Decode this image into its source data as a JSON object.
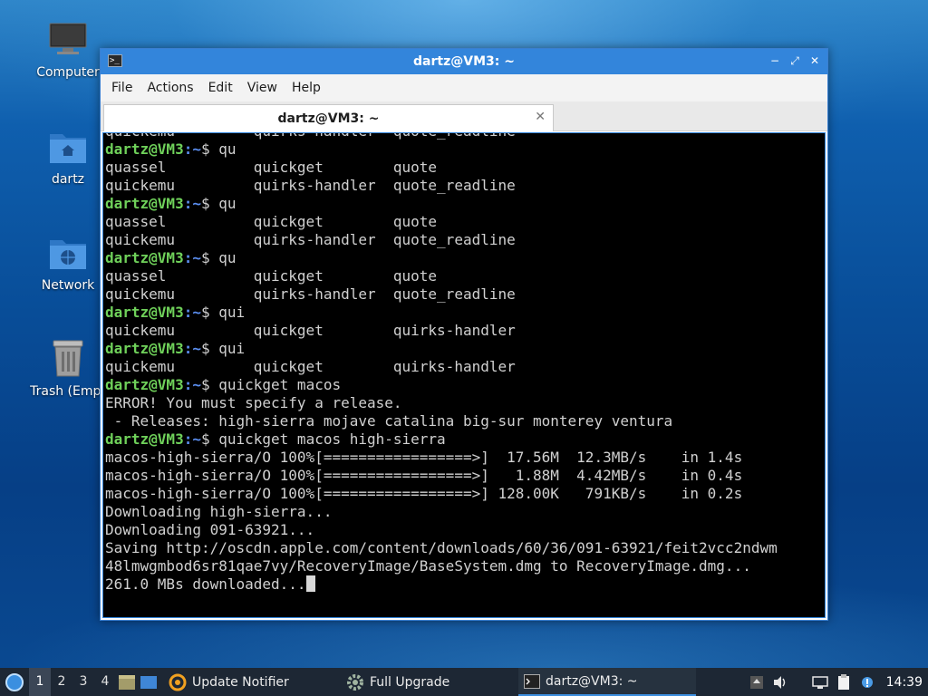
{
  "desktop": {
    "icons": [
      {
        "label": "Computer"
      },
      {
        "label": "dartz"
      },
      {
        "label": "Network"
      },
      {
        "label": "Trash (Empt"
      }
    ]
  },
  "window": {
    "title": "dartz@VM3: ~",
    "menu": [
      "File",
      "Actions",
      "Edit",
      "View",
      "Help"
    ],
    "tab": {
      "label": "dartz@VM3: ~",
      "close": "✕"
    },
    "buttons": {
      "minimize": "−",
      "maximize": "⤢",
      "close": "✕"
    }
  },
  "terminal": {
    "prompt_user": "dartz@VM3",
    "prompt_path": ":~",
    "prompt_sign": "$ ",
    "lines": [
      {
        "t": "out",
        "text": "quickemu         quirks-handler  quote_readline"
      },
      {
        "t": "cmd",
        "text": "qu"
      },
      {
        "t": "out",
        "text": "quassel          quickget        quote"
      },
      {
        "t": "out",
        "text": "quickemu         quirks-handler  quote_readline"
      },
      {
        "t": "cmd",
        "text": "qu"
      },
      {
        "t": "out",
        "text": "quassel          quickget        quote"
      },
      {
        "t": "out",
        "text": "quickemu         quirks-handler  quote_readline"
      },
      {
        "t": "cmd",
        "text": "qu"
      },
      {
        "t": "out",
        "text": "quassel          quickget        quote"
      },
      {
        "t": "out",
        "text": "quickemu         quirks-handler  quote_readline"
      },
      {
        "t": "cmd",
        "text": "qui"
      },
      {
        "t": "out",
        "text": "quickemu         quickget        quirks-handler"
      },
      {
        "t": "cmd",
        "text": "qui"
      },
      {
        "t": "out",
        "text": "quickemu         quickget        quirks-handler"
      },
      {
        "t": "cmd",
        "text": "quickget macos"
      },
      {
        "t": "out",
        "text": "ERROR! You must specify a release."
      },
      {
        "t": "out",
        "text": " - Releases: high-sierra mojave catalina big-sur monterey ventura"
      },
      {
        "t": "cmd",
        "text": "quickget macos high-sierra"
      },
      {
        "t": "out",
        "text": "macos-high-sierra/O 100%[=================>]  17.56M  12.3MB/s    in 1.4s"
      },
      {
        "t": "out",
        "text": "macos-high-sierra/O 100%[=================>]   1.88M  4.42MB/s    in 0.4s"
      },
      {
        "t": "out",
        "text": "macos-high-sierra/O 100%[=================>] 128.00K   791KB/s    in 0.2s"
      },
      {
        "t": "out",
        "text": "Downloading high-sierra..."
      },
      {
        "t": "out",
        "text": "Downloading 091-63921..."
      },
      {
        "t": "out",
        "text": "Saving http://oscdn.apple.com/content/downloads/60/36/091-63921/feit2vcc2ndwm"
      },
      {
        "t": "out",
        "text": "48lmwgmbod6sr81qae7vy/RecoveryImage/BaseSystem.dmg to RecoveryImage.dmg..."
      },
      {
        "t": "out",
        "text": "261.0 MBs downloaded...",
        "cursor": true
      }
    ]
  },
  "taskbar": {
    "workspaces": [
      "1",
      "2",
      "3",
      "4"
    ],
    "active_workspace": "1",
    "tasks": [
      {
        "label": "Update Notifier"
      },
      {
        "label": "Full Upgrade"
      },
      {
        "label": "dartz@VM3: ~"
      }
    ],
    "clock": "14:39"
  },
  "colors": {
    "titlebar": "#3385db",
    "prompt_user": "#6fd15a",
    "prompt_path": "#5b8ef0",
    "terminal_bg": "#000000"
  }
}
